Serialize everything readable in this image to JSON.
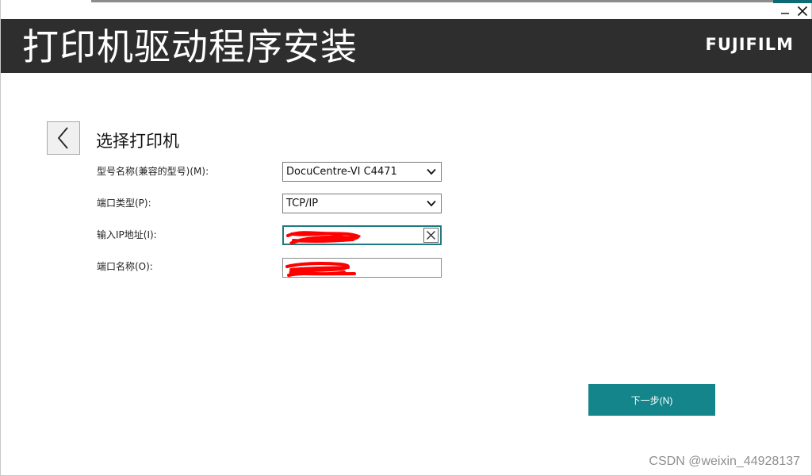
{
  "window": {
    "title": "打印机驱动程序安装",
    "brand": "FUJIFILM"
  },
  "controls": {
    "minimize_icon": "minimize-icon",
    "close_icon": "close-icon"
  },
  "section": {
    "title": "选择打印机"
  },
  "form": {
    "model": {
      "label": "型号名称(兼容的型号)(M):",
      "value": "DocuCentre-VI C4471"
    },
    "port_type": {
      "label": "端口类型(P):",
      "value": "TCP/IP"
    },
    "ip_address": {
      "label": "输入IP地址(I):"
    },
    "port_name": {
      "label": "端口名称(O):"
    }
  },
  "buttons": {
    "next": "下一步(N)"
  },
  "watermark": "CSDN @weixin_44928137",
  "colors": {
    "banner": "#2e2e2e",
    "accent": "#13858b",
    "redaction": "#ff0000"
  }
}
